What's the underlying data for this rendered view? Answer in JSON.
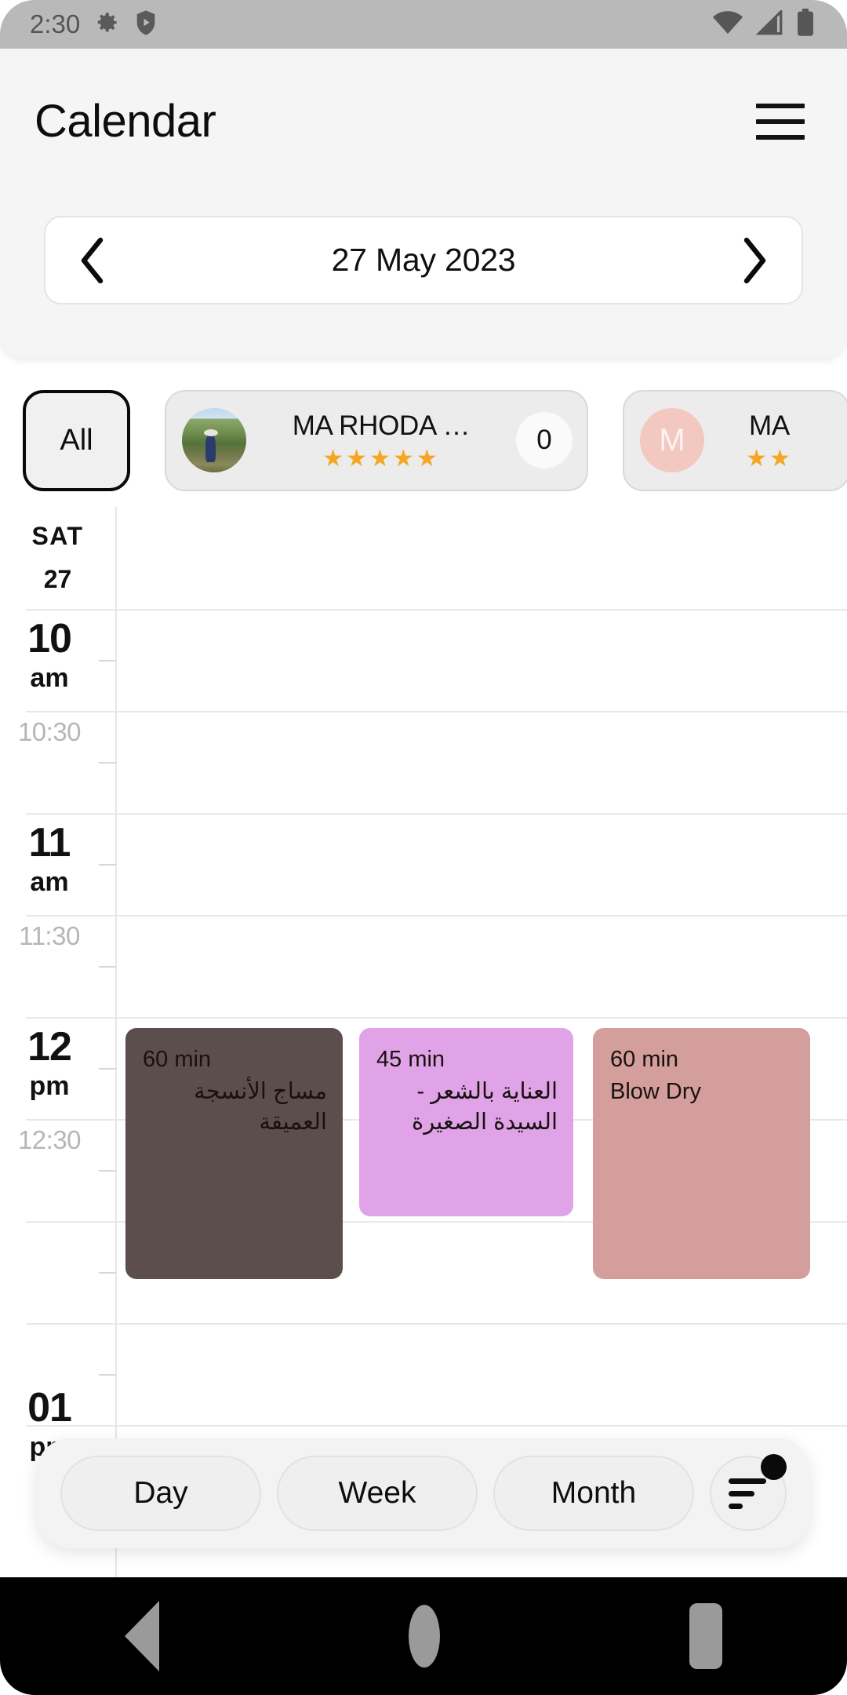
{
  "status_bar": {
    "time": "2:30",
    "left_icons": [
      "gear-icon",
      "shield-play-icon"
    ],
    "right_icons": [
      "wifi-icon",
      "cellular-signal-icon",
      "battery-icon"
    ],
    "background": "#b9b9b9"
  },
  "header": {
    "title": "Calendar",
    "menu_icon": "hamburger-menu-icon"
  },
  "date_nav": {
    "prev_label": "‹",
    "next_label": "›",
    "date": "27 May 2023"
  },
  "staff_filter": {
    "all_label": "All",
    "chips": [
      {
        "name": "MA RHODA …",
        "avatar_type": "photo",
        "avatar_initial": "",
        "stars": "★★★★★",
        "rating": 5,
        "badge": "0"
      },
      {
        "name": "MA",
        "avatar_type": "initial",
        "avatar_initial": "M",
        "stars": "★★",
        "rating": 2,
        "badge": ""
      }
    ]
  },
  "day_column": {
    "day_of_week": "SAT",
    "day_number": "27"
  },
  "time_axis": {
    "hours": [
      {
        "hour": "10",
        "meridiem": "am",
        "half": "10:30"
      },
      {
        "hour": "11",
        "meridiem": "am",
        "half": "11:30"
      },
      {
        "hour": "12",
        "meridiem": "pm",
        "half": "12:30"
      },
      {
        "hour": "01",
        "meridiem": "pm",
        "half": ""
      }
    ]
  },
  "events": [
    {
      "duration": "60 min",
      "title": "مساج الأنسجة العميقة",
      "color": "#5c4e4c",
      "rtl": true,
      "start": "12:00 pm"
    },
    {
      "duration": "45 min",
      "title": "العناية بالشعر - السيدة الصغيرة",
      "color": "#e0a3e8",
      "rtl": true,
      "start": "12:00 pm"
    },
    {
      "duration": "60 min",
      "title": "Blow Dry",
      "color": "#d39e9c",
      "rtl": false,
      "start": "12:00 pm"
    }
  ],
  "view_bar": {
    "day_label": "Day",
    "week_label": "Week",
    "month_label": "Month",
    "filter_icon": "filter-lines-icon",
    "filter_has_badge": true
  },
  "nav_bar": {
    "back": "back-triangle-icon",
    "home": "home-circle-icon",
    "recents": "recents-square-icon"
  }
}
